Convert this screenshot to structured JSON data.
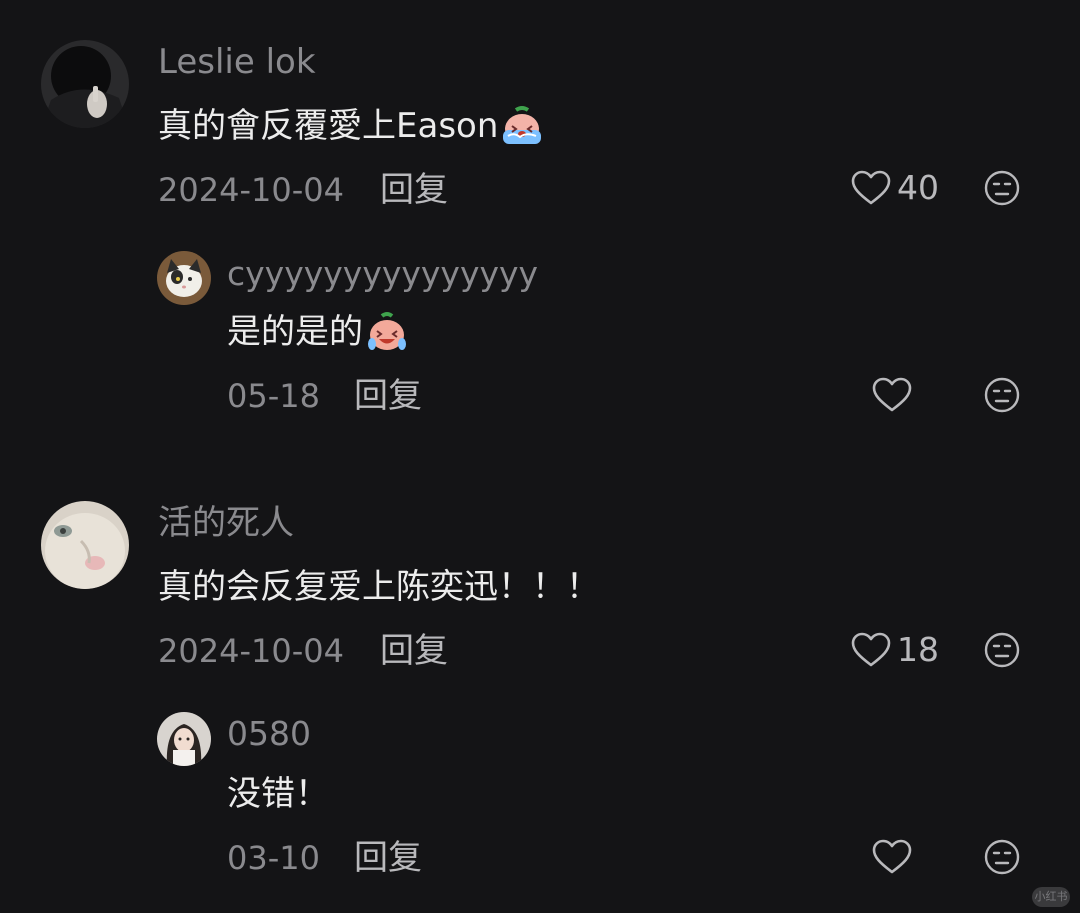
{
  "comments": [
    {
      "username": "Leslie lok",
      "content": "真的會反覆愛上Eason",
      "emoji": "crying-face-emoji",
      "date": "2024-10-04",
      "reply_label": "回复",
      "likes": "40",
      "replies": [
        {
          "username": "cyyyyyyyyyyyyyyy",
          "content": "是的是的",
          "emoji": "laugh-cry-face-emoji",
          "date": "05-18",
          "reply_label": "回复",
          "likes": ""
        }
      ]
    },
    {
      "username": "活的死人",
      "content": "真的会反复爱上陈奕迅！！！",
      "date": "2024-10-04",
      "reply_label": "回复",
      "likes": "18",
      "replies": [
        {
          "username": "0580",
          "content": "没错！",
          "date": "03-10",
          "reply_label": "回复",
          "likes": ""
        }
      ]
    }
  ],
  "watermark": "小红书",
  "colors": {
    "background": "#141416",
    "muted_text": "#8a8a8e",
    "primary_text": "#ececec",
    "icon": "#b9b9bc"
  }
}
